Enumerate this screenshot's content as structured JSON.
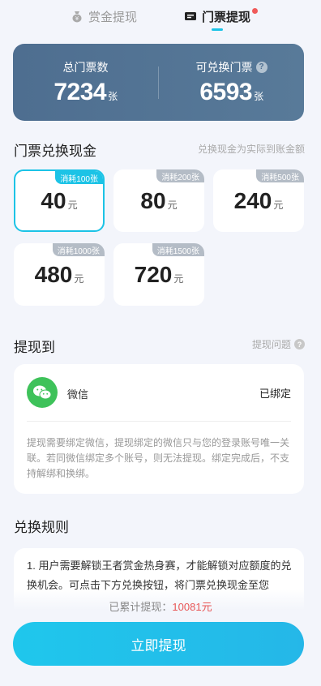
{
  "tabs": [
    {
      "label": "赏金提现",
      "icon": "money-bag-icon",
      "active": false
    },
    {
      "label": "门票提现",
      "icon": "ticket-icon",
      "active": true,
      "has_dot": true
    }
  ],
  "stats": {
    "total_label": "总门票数",
    "total_value": "7234",
    "total_unit": "张",
    "exchangeable_label": "可兑换门票",
    "exchangeable_value": "6593",
    "exchangeable_unit": "张"
  },
  "exchange": {
    "title": "门票兑换现金",
    "hint": "兑换现金为实际到账金额",
    "options": [
      {
        "badge": "消耗100张",
        "amount": "40",
        "unit": "元",
        "selected": true
      },
      {
        "badge": "消耗200张",
        "amount": "80",
        "unit": "元",
        "selected": false
      },
      {
        "badge": "消耗500张",
        "amount": "240",
        "unit": "元",
        "selected": false
      },
      {
        "badge": "消耗1000张",
        "amount": "480",
        "unit": "元",
        "selected": false
      },
      {
        "badge": "消耗1500张",
        "amount": "720",
        "unit": "元",
        "selected": false
      }
    ]
  },
  "withdraw_to": {
    "title": "提现到",
    "help_label": "提现问题",
    "account_name": "微信",
    "account_status": "已绑定",
    "note": "提现需要绑定微信，提现绑定的微信只与您的登录账号唯一关联。若同微信绑定多个账号，则无法提现。绑定完成后，不支持解绑和换绑。"
  },
  "rules": {
    "title": "兑换规则",
    "text": "1. 用户需要解锁王者赏金热身赛，才能解锁对应额度的兑换机会。可点击下方兑换按钮，将门票兑换现金至您"
  },
  "footer": {
    "total_label": "已累计提现：",
    "total_value": "10081元",
    "button_label": "立即提现"
  },
  "colors": {
    "accent": "#1cc3e6",
    "stats_bg": "#4e6e90",
    "wechat": "#3ec25a",
    "highlight": "#e85656"
  }
}
